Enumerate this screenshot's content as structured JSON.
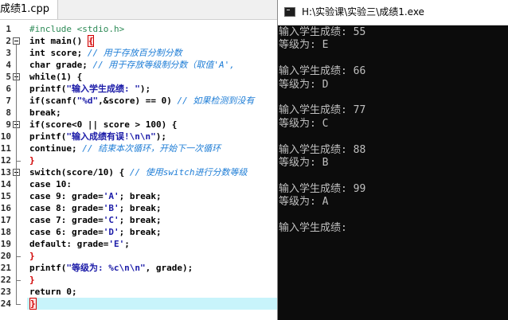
{
  "editor": {
    "tab_label": "成绩1.cpp",
    "line_numbers": [
      "1",
      "2",
      "3",
      "4",
      "5",
      "6",
      "7",
      "8",
      "9",
      "10",
      "11",
      "12",
      "13",
      "14",
      "15",
      "16",
      "17",
      "18",
      "19",
      "20",
      "21",
      "22",
      "23",
      "24"
    ]
  },
  "code": [
    {
      "segments": [
        {
          "c": "pp",
          "t": "#include <stdio.h>"
        }
      ]
    },
    {
      "segments": [
        {
          "c": "kw",
          "t": "int main() "
        },
        {
          "c": "brbox",
          "t": "{"
        }
      ]
    },
    {
      "segments": [
        {
          "c": "kw",
          "t": "int score; "
        },
        {
          "c": "cm",
          "t": "// 用于存放百分制分数"
        }
      ]
    },
    {
      "segments": [
        {
          "c": "kw",
          "t": "char grade; "
        },
        {
          "c": "cm",
          "t": "// 用于存放等级制分数（取值'A',"
        }
      ]
    },
    {
      "segments": [
        {
          "c": "kw",
          "t": "while(1) {"
        }
      ]
    },
    {
      "segments": [
        {
          "c": "kw",
          "t": "printf("
        },
        {
          "c": "str",
          "t": "\"输入学生成绩: \""
        },
        {
          "c": "kw",
          "t": ");"
        }
      ]
    },
    {
      "segments": [
        {
          "c": "kw",
          "t": "if(scanf("
        },
        {
          "c": "str",
          "t": "\"%d\""
        },
        {
          "c": "kw",
          "t": ",&score) == 0) "
        },
        {
          "c": "cm",
          "t": "// 如果检测到没有"
        }
      ]
    },
    {
      "segments": [
        {
          "c": "kw",
          "t": "break;"
        }
      ]
    },
    {
      "segments": [
        {
          "c": "kw",
          "t": "if(score<0 || score > 100) {"
        }
      ]
    },
    {
      "segments": [
        {
          "c": "kw",
          "t": "printf("
        },
        {
          "c": "str",
          "t": "\"输入成绩有误!\\n\\n\""
        },
        {
          "c": "kw",
          "t": ");"
        }
      ]
    },
    {
      "segments": [
        {
          "c": "kw",
          "t": "continue; "
        },
        {
          "c": "cm",
          "t": "// 结束本次循环，开始下一次循环"
        }
      ]
    },
    {
      "segments": [
        {
          "c": "br",
          "t": "}"
        }
      ]
    },
    {
      "segments": [
        {
          "c": "kw",
          "t": "switch(score/10) { "
        },
        {
          "c": "cm",
          "t": "// 使用switch进行分数等级"
        }
      ]
    },
    {
      "segments": [
        {
          "c": "kw",
          "t": "case 10:"
        }
      ]
    },
    {
      "segments": [
        {
          "c": "kw",
          "t": "case 9: grade="
        },
        {
          "c": "str",
          "t": "'A'"
        },
        {
          "c": "kw",
          "t": "; break;"
        }
      ]
    },
    {
      "segments": [
        {
          "c": "kw",
          "t": "case 8: grade="
        },
        {
          "c": "str",
          "t": "'B'"
        },
        {
          "c": "kw",
          "t": "; break;"
        }
      ]
    },
    {
      "segments": [
        {
          "c": "kw",
          "t": "case 7: grade="
        },
        {
          "c": "str",
          "t": "'C'"
        },
        {
          "c": "kw",
          "t": "; break;"
        }
      ]
    },
    {
      "segments": [
        {
          "c": "kw",
          "t": "case 6: grade="
        },
        {
          "c": "str",
          "t": "'D'"
        },
        {
          "c": "kw",
          "t": "; break;"
        }
      ]
    },
    {
      "segments": [
        {
          "c": "kw",
          "t": "default: grade="
        },
        {
          "c": "str",
          "t": "'E'"
        },
        {
          "c": "kw",
          "t": ";"
        }
      ]
    },
    {
      "segments": [
        {
          "c": "br",
          "t": "}"
        }
      ]
    },
    {
      "segments": [
        {
          "c": "kw",
          "t": "printf("
        },
        {
          "c": "str",
          "t": "\"等级为: %c\\n\\n\""
        },
        {
          "c": "kw",
          "t": ", grade);"
        }
      ]
    },
    {
      "segments": [
        {
          "c": "br",
          "t": "}"
        }
      ]
    },
    {
      "segments": [
        {
          "c": "kw",
          "t": "return 0;"
        }
      ]
    },
    {
      "segments": [
        {
          "c": "brbox",
          "t": "}"
        }
      ]
    }
  ],
  "console": {
    "title": "H:\\实验课\\实验三\\成绩1.exe",
    "lines": [
      "输入学生成绩: 55",
      "等级为: E",
      "",
      "输入学生成绩: 66",
      "等级为: D",
      "",
      "输入学生成绩: 77",
      "等级为: C",
      "",
      "输入学生成绩: 88",
      "等级为: B",
      "",
      "输入学生成绩: 99",
      "等级为: A",
      "",
      "输入学生成绩:"
    ]
  },
  "colors": {
    "comment": "#1e7dd6",
    "string": "#1b1ba8",
    "preprocessor": "#2e8b57",
    "brace_match": "#d00000",
    "current_line": "#c8f4fb",
    "console_bg": "#0c0c0c",
    "console_text": "#c0c0c0"
  }
}
